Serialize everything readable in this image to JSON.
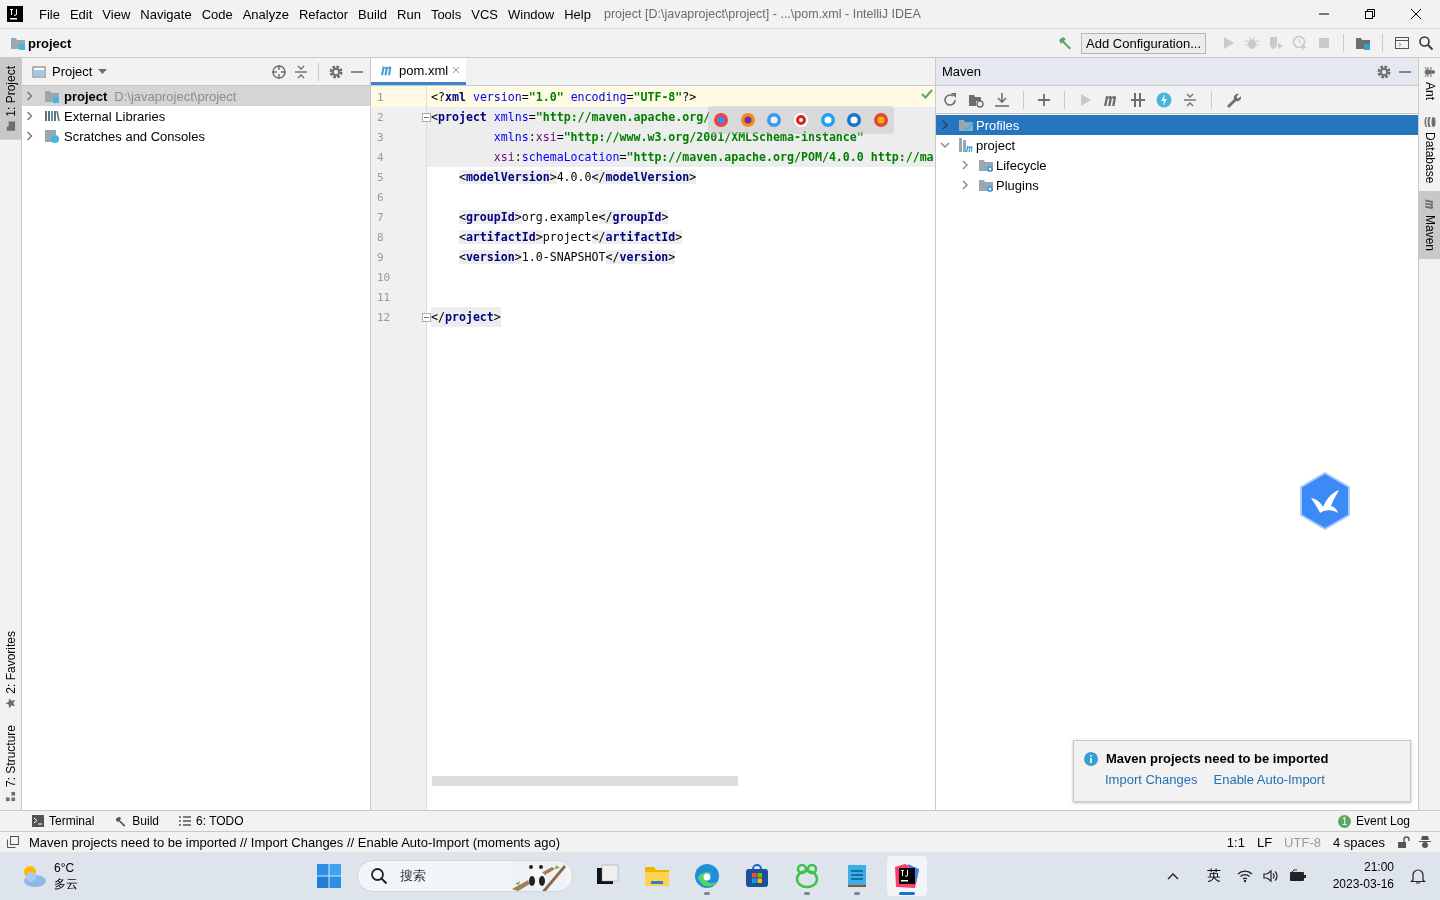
{
  "title_bar": {
    "menu": [
      "File",
      "Edit",
      "View",
      "Navigate",
      "Code",
      "Analyze",
      "Refactor",
      "Build",
      "Run",
      "Tools",
      "VCS",
      "Window",
      "Help"
    ],
    "title": "project [D:\\javaproject\\project] - ...\\pom.xml - IntelliJ IDEA"
  },
  "nav_bar": {
    "breadcrumb": "project",
    "run_config": "Add Configuration..."
  },
  "left_strip": [
    {
      "label": "1: Project",
      "selected": true,
      "kind": "project"
    },
    {
      "label": "2: Favorites",
      "selected": false,
      "kind": "favorites"
    },
    {
      "label": "7: Structure",
      "selected": false,
      "kind": "structure"
    }
  ],
  "project_panel": {
    "title": "Project",
    "tree": [
      {
        "label": "project",
        "path": "D:\\javaproject\\project",
        "selected": true,
        "kind": "module"
      },
      {
        "label": "External Libraries",
        "selected": false,
        "kind": "libraries"
      },
      {
        "label": "Scratches and Consoles",
        "selected": false,
        "kind": "scratches"
      }
    ]
  },
  "editor": {
    "tabs": [
      {
        "label": "pom.xml",
        "selected": true
      }
    ],
    "lines": [
      {
        "number": "1",
        "current": true,
        "kind": "decl",
        "fold": false,
        "tokens": [
          {
            "kind": "punct",
            "s": "<?"
          },
          {
            "kind": "tag",
            "s": "xml"
          },
          {
            "kind": "attr",
            "s": " version"
          },
          {
            "kind": "punct",
            "s": "="
          },
          {
            "kind": "value",
            "s": "\"1.0\""
          },
          {
            "kind": "attr",
            "s": " encoding"
          },
          {
            "kind": "punct",
            "s": "="
          },
          {
            "kind": "value",
            "s": "\"UTF-8\""
          },
          {
            "kind": "punct",
            "s": "?>"
          }
        ]
      },
      {
        "number": "2",
        "current": false,
        "kind": "open",
        "fold": true,
        "tokens": [
          {
            "kind": "punct",
            "s": "<"
          },
          {
            "kind": "tag",
            "s": "project"
          },
          {
            "kind": "attr",
            "s": " xmlns"
          },
          {
            "kind": "punct",
            "s": "="
          },
          {
            "kind": "value",
            "s": "\"http://maven.apache.org/"
          }
        ]
      },
      {
        "number": "3",
        "current": false,
        "kind": "attr",
        "fold": false,
        "tokens": [
          {
            "kind": "attr",
            "s": "xmlns"
          },
          {
            "kind": "punct",
            "s": ":"
          },
          {
            "kind": "ns",
            "s": "xsi"
          },
          {
            "kind": "punct",
            "s": "="
          },
          {
            "kind": "value",
            "s": "\"http://www.w3.org/2001/XMLSchema-instance\""
          }
        ]
      },
      {
        "number": "4",
        "current": false,
        "kind": "attr",
        "fold": false,
        "tokens": [
          {
            "kind": "ns",
            "s": "xsi"
          },
          {
            "kind": "punct",
            "s": ":"
          },
          {
            "kind": "attr",
            "s": "schemaLocation"
          },
          {
            "kind": "punct",
            "s": "="
          },
          {
            "kind": "value",
            "s": "\"http://maven.apache.org/POM/4.0.0 http://ma"
          }
        ]
      },
      {
        "number": "5",
        "current": false,
        "kind": "child",
        "fold": false,
        "tokens": [
          {
            "kind": "punct",
            "s": "<"
          },
          {
            "kind": "tag",
            "s": "modelVersion"
          },
          {
            "kind": "punct",
            "s": ">"
          },
          {
            "kind": "text",
            "s": "4.0.0"
          },
          {
            "kind": "punct",
            "s": "</"
          },
          {
            "kind": "tag",
            "s": "modelVersion"
          },
          {
            "kind": "punct",
            "s": ">"
          }
        ]
      },
      {
        "number": "6",
        "current": false,
        "kind": "blank",
        "fold": false
      },
      {
        "number": "7",
        "current": false,
        "kind": "child",
        "fold": false,
        "tokens": [
          {
            "kind": "punct",
            "s": "<"
          },
          {
            "kind": "tag",
            "s": "groupId"
          },
          {
            "kind": "punct",
            "s": ">"
          },
          {
            "kind": "text",
            "s": "org.example"
          },
          {
            "kind": "punct",
            "s": "</"
          },
          {
            "kind": "tag",
            "s": "groupId"
          },
          {
            "kind": "punct",
            "s": ">"
          }
        ]
      },
      {
        "number": "8",
        "current": false,
        "kind": "child",
        "fold": false,
        "tokens": [
          {
            "kind": "punct",
            "s": "<"
          },
          {
            "kind": "tag",
            "s": "artifactId"
          },
          {
            "kind": "punct",
            "s": ">"
          },
          {
            "kind": "text",
            "s": "project"
          },
          {
            "kind": "punct",
            "s": "</"
          },
          {
            "kind": "tag",
            "s": "artifactId"
          },
          {
            "kind": "punct",
            "s": ">"
          }
        ]
      },
      {
        "number": "9",
        "current": false,
        "kind": "child",
        "fold": false,
        "tokens": [
          {
            "kind": "punct",
            "s": "<"
          },
          {
            "kind": "tag",
            "s": "version"
          },
          {
            "kind": "punct",
            "s": ">"
          },
          {
            "kind": "text",
            "s": "1.0-SNAPSHOT"
          },
          {
            "kind": "punct",
            "s": "</"
          },
          {
            "kind": "tag",
            "s": "version"
          },
          {
            "kind": "punct",
            "s": ">"
          }
        ]
      },
      {
        "number": "10",
        "current": false,
        "kind": "blank",
        "fold": false
      },
      {
        "number": "11",
        "current": false,
        "kind": "blank",
        "fold": false
      },
      {
        "number": "12",
        "current": false,
        "kind": "close",
        "fold": true,
        "tokens": [
          {
            "kind": "punct",
            "s": "</"
          },
          {
            "kind": "tag",
            "s": "project"
          },
          {
            "kind": "punct",
            "s": ">"
          }
        ]
      }
    ]
  },
  "maven": {
    "title": "Maven",
    "tree": [
      {
        "label": "Profiles",
        "selected": true,
        "expanded": false,
        "kind": "profiles"
      },
      {
        "label": "project",
        "selected": false,
        "expanded": true,
        "kind": "project",
        "children": [
          {
            "label": "Lifecycle",
            "selected": false,
            "expanded": false
          },
          {
            "label": "Plugins",
            "selected": false,
            "expanded": false
          }
        ]
      }
    ]
  },
  "right_strip": [
    {
      "label": "Ant",
      "selected": false,
      "kind": "ant"
    },
    {
      "label": "Database",
      "selected": false,
      "kind": "database"
    },
    {
      "label": "Maven",
      "selected": true,
      "kind": "maven"
    }
  ],
  "notification": {
    "title": "Maven projects need to be imported",
    "actions": [
      "Import Changes",
      "Enable Auto-Import"
    ]
  },
  "bottom_tools": [
    {
      "label": "Terminal",
      "kind": "terminal"
    },
    {
      "label": "Build",
      "kind": "build"
    },
    {
      "label": "6: TODO",
      "kind": "todo"
    }
  ],
  "event_log": {
    "count": "1",
    "label": "Event Log"
  },
  "status_bar": {
    "message": "Maven projects need to be imported // Import Changes // Enable Auto-Import (moments ago)",
    "items": [
      {
        "text": "1:1",
        "disabled": false
      },
      {
        "text": "LF",
        "disabled": false
      },
      {
        "text": "UTF-8",
        "disabled": true
      },
      {
        "text": "4 spaces",
        "disabled": false
      }
    ]
  },
  "taskbar": {
    "weather": {
      "temperature": "6°C",
      "condition": "多云"
    },
    "search_placeholder": "搜索",
    "apps": [
      {
        "kind": "taskview",
        "running": false,
        "selected": false
      },
      {
        "kind": "folder",
        "running": false,
        "selected": false
      },
      {
        "kind": "edge",
        "running": true,
        "selected": false
      },
      {
        "kind": "store",
        "running": false,
        "selected": false
      },
      {
        "kind": "frog",
        "running": true,
        "selected": false
      },
      {
        "kind": "notepad",
        "running": true,
        "selected": false
      },
      {
        "kind": "idea",
        "running": true,
        "selected": true
      }
    ],
    "ime": "英",
    "time": "21:00",
    "date": "2023-03-16"
  }
}
